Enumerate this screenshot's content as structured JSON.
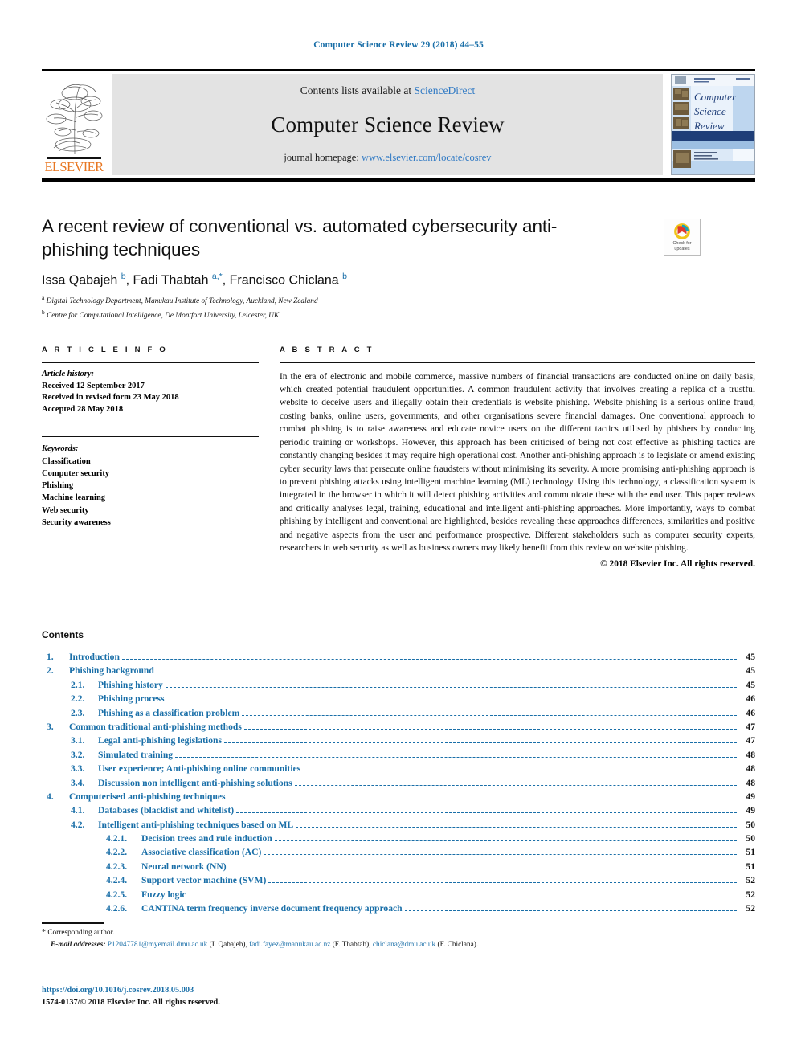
{
  "running_head": "Computer Science Review 29 (2018) 44–55",
  "masthead": {
    "contents_prefix": "Contents lists available at ",
    "sciencedirect": "ScienceDirect",
    "journal_name": "Computer Science Review",
    "homepage_prefix": "journal homepage: ",
    "homepage_url": "www.elsevier.com/locate/cosrev",
    "publisher": "ELSEVIER",
    "cover_title_1": "Computer",
    "cover_title_2": "Science",
    "cover_title_3": "Review",
    "accent_orange": "#E87722",
    "link_blue": "#2f79c4"
  },
  "crossmark": {
    "line1": "Check for",
    "line2": "updates"
  },
  "article": {
    "title": "A recent review of conventional vs. automated cybersecurity anti-phishing techniques",
    "authors_html": "Issa Qabajeh <sup>b</sup>, Fadi Thabtah <sup>a,*</sup>, Francisco Chiclana <sup>b</sup>",
    "affiliation_a": "Digital Technology Department, Manukau Institute of Technology, Auckland, New Zealand",
    "affiliation_b": "Centre for Computational Intelligence, De Montfort University, Leicester, UK"
  },
  "article_info": {
    "heading": "A R T I C L E   I N F O",
    "history_label": "Article history:",
    "history": [
      "Received 12 September 2017",
      "Received in revised form 23 May 2018",
      "Accepted 28 May 2018"
    ],
    "keywords_label": "Keywords:",
    "keywords": [
      "Classification",
      "Computer security",
      "Phishing",
      "Machine learning",
      "Web security",
      "Security awareness"
    ]
  },
  "abstract": {
    "heading": "A B S T R A C T",
    "body": "In the era of electronic and mobile commerce, massive numbers of financial transactions are conducted online on daily basis, which created potential fraudulent opportunities. A common fraudulent activity that involves creating a replica of a trustful website to deceive users and illegally obtain their credentials is website phishing. Website phishing is a serious online fraud, costing banks, online users, governments, and other organisations severe financial damages. One conventional approach to combat phishing is to raise awareness and educate novice users on the different tactics utilised by phishers by conducting periodic training or workshops. However, this approach has been criticised of being not cost effective as phishing tactics are constantly changing besides it may require high operational cost. Another anti-phishing approach is to legislate or amend existing cyber security laws that persecute online fraudsters without minimising its severity. A more promising anti-phishing approach is to prevent phishing attacks using intelligent machine learning (ML) technology. Using this technology, a classification system is integrated in the browser in which it will detect phishing activities and communicate these with the end user. This paper reviews and critically analyses legal, training, educational and intelligent anti-phishing approaches. More importantly, ways to combat phishing by intelligent and conventional are highlighted, besides revealing these approaches differences, similarities and positive and negative aspects from the user and performance prospective. Different stakeholders such as computer security experts, researchers in web security as well as business owners may likely benefit from this review on website phishing.",
    "copyright": "© 2018 Elsevier Inc. All rights reserved."
  },
  "contents": {
    "heading": "Contents",
    "entries": [
      {
        "level": 1,
        "num": "1.",
        "label": "Introduction",
        "page": "45"
      },
      {
        "level": 1,
        "num": "2.",
        "label": "Phishing background",
        "page": "45"
      },
      {
        "level": 2,
        "num": "2.1.",
        "label": "Phishing history",
        "page": "45"
      },
      {
        "level": 2,
        "num": "2.2.",
        "label": "Phishing process",
        "page": "46"
      },
      {
        "level": 2,
        "num": "2.3.",
        "label": "Phishing as a classification problem",
        "page": "46"
      },
      {
        "level": 1,
        "num": "3.",
        "label": "Common traditional anti-phishing methods",
        "page": "47"
      },
      {
        "level": 2,
        "num": "3.1.",
        "label": "Legal anti-phishing legislations",
        "page": "47"
      },
      {
        "level": 2,
        "num": "3.2.",
        "label": "Simulated training",
        "page": "48"
      },
      {
        "level": 2,
        "num": "3.3.",
        "label": "User experience; Anti-phishing online communities",
        "page": "48"
      },
      {
        "level": 2,
        "num": "3.4.",
        "label": "Discussion non intelligent anti-phishing solutions",
        "page": "48"
      },
      {
        "level": 1,
        "num": "4.",
        "label": "Computerised anti-phishing techniques",
        "page": "49"
      },
      {
        "level": 2,
        "num": "4.1.",
        "label": "Databases (blacklist and whitelist)",
        "page": "49"
      },
      {
        "level": 2,
        "num": "4.2.",
        "label": "Intelligent anti-phishing techniques based on ML",
        "page": "50"
      },
      {
        "level": 3,
        "num": "4.2.1.",
        "label": "Decision trees and rule induction",
        "page": "50"
      },
      {
        "level": 3,
        "num": "4.2.2.",
        "label": "Associative classification (AC)",
        "page": "51"
      },
      {
        "level": 3,
        "num": "4.2.3.",
        "label": "Neural network (NN)",
        "page": "51"
      },
      {
        "level": 3,
        "num": "4.2.4.",
        "label": "Support vector machine (SVM)",
        "page": "52"
      },
      {
        "level": 3,
        "num": "4.2.5.",
        "label": "Fuzzy logic",
        "page": "52"
      },
      {
        "level": 3,
        "num": "4.2.6.",
        "label": "CANTINA term frequency inverse document frequency approach",
        "page": "52"
      }
    ]
  },
  "footnotes": {
    "corresponding": "Corresponding author.",
    "emails_label": "E-mail addresses:",
    "email_1": "P12047781@myemail.dmu.ac.uk",
    "email_1_name": " (I. Qabajeh), ",
    "email_2": "fadi.fayez@manukau.ac.nz",
    "email_2_name": " (F. Thabtah), ",
    "email_3": "chiclana@dmu.ac.uk",
    "email_3_name": " (F. Chiclana)."
  },
  "bottom": {
    "doi": "https://doi.org/10.1016/j.cosrev.2018.05.003",
    "issn_line": "1574-0137/© 2018 Elsevier Inc. All rights reserved."
  }
}
